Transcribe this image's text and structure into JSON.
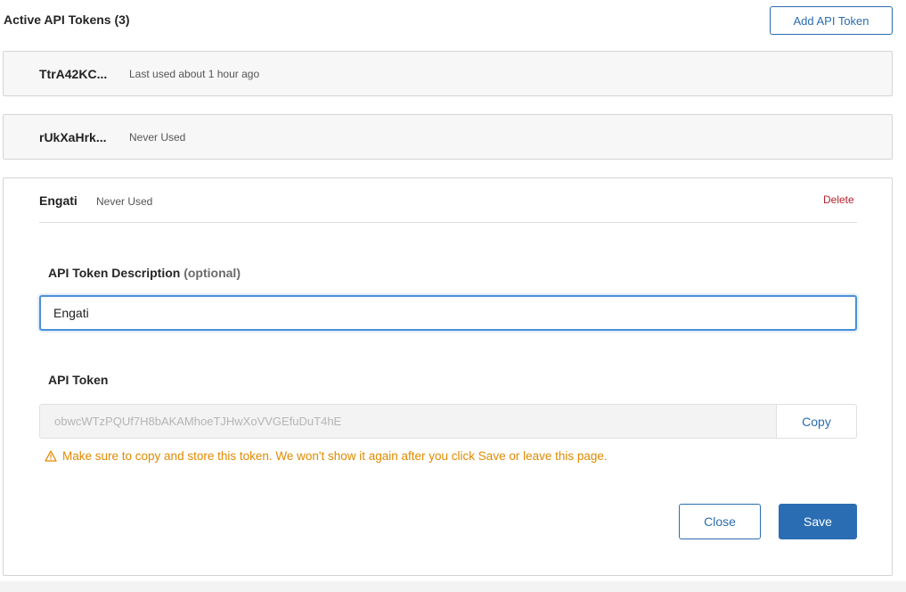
{
  "header": {
    "title": "Active API Tokens (3)",
    "add_button_label": "Add API Token"
  },
  "tokens": [
    {
      "name": "TtrA42KC...",
      "status": "Last used about 1 hour ago"
    },
    {
      "name": "rUkXaHrk...",
      "status": "Never Used"
    }
  ],
  "expanded": {
    "name": "Engati",
    "status": "Never Used",
    "delete_label": "Delete",
    "description_label": "API Token Description",
    "description_optional": "(optional)",
    "description_value": "Engati",
    "token_label": "API Token",
    "token_value": "obwcWTzPQUf7H8bAKAMhoeTJHwXoVVGEfuDuT4hE",
    "copy_label": "Copy",
    "warning_text": "Make sure to copy and store this token. We won't show it again after you click Save or leave this page.",
    "close_label": "Close",
    "save_label": "Save"
  },
  "colors": {
    "accent": "#2b6cb0",
    "danger": "#b8202a",
    "warning": "#e08a00"
  },
  "icons": {
    "warning": "warning-triangle-icon"
  }
}
